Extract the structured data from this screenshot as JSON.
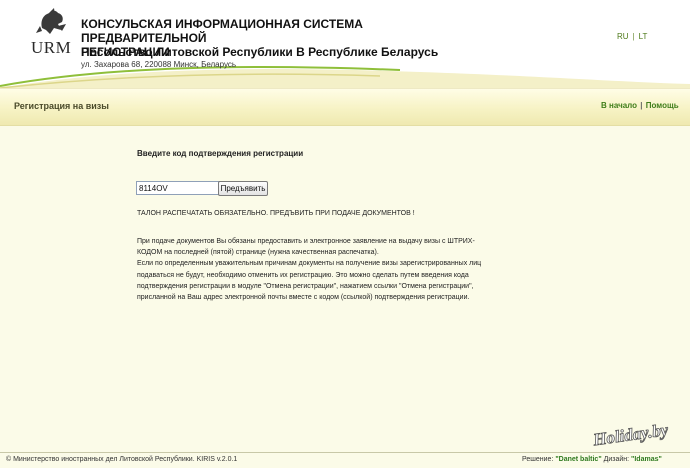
{
  "header": {
    "logo_text": "URM",
    "title_line1": "КОНСУЛЬСКАЯ ИНФОРМАЦИОННАЯ СИСТЕМА ПРЕДВАРИТЕЛЬНОЙ",
    "title_line2": "РЕГИСТРАЦИИ",
    "subtitle": "Посольство Литовской Республики В Республике Беларусь",
    "address": "ул. Захарова 68, 220088 Минск, Беларусь",
    "lang": {
      "ru": "RU",
      "separator": "|",
      "lt": "LT"
    }
  },
  "bar": {
    "title": "Регистрация на визы",
    "link_home": "В начало",
    "link_separator": "|",
    "link_help": "Помощь"
  },
  "form": {
    "prompt": "Введите код подтверждения регистрации",
    "code_value": "8114OV",
    "submit_label": "Предъявить"
  },
  "notice": "ТАЛОН РАСПЕЧАТАТЬ ОБЯЗАТЕЛЬНО. ПРЕДЪВИТЬ ПРИ ПОДАЧЕ ДОКУМЕНТОВ !",
  "info_lines": [
    "При подаче документов Вы обязаны предоставить и электронное заявление на выдачу визы с ШТРИХ-",
    "КОДОМ на последней (пятой) странице (нужна качественная распечатка).",
    "Если по определенным уважительным причинам документы на получение визы зарегистрированных лиц",
    "подаваться не будут, необходимо отменить их регистрацию. Это можно сделать путем введения кода",
    "подтверждения регистрации в модуле \"Отмена регистрации\", нажатием ссылки \"Отмена регистрации\",",
    "присланной на Ваш адрес электронной почты вместе с кодом (ссылкой) подтверждения регистрации."
  ],
  "footer": {
    "left": "© Министерство иностранных дел Литовской Республики. KIRIS v.2.0.1",
    "solution_label": "Решение: ",
    "solution_value": "\"Danet baltic\"",
    "design_label": " Дизайн: ",
    "design_value": "\"Idamas\""
  },
  "watermark": "Holiday.by",
  "colors": {
    "accent_green": "#3f7d1a",
    "page_bg": "#fbfbe8",
    "bar_bg": "#f7f3c5"
  }
}
